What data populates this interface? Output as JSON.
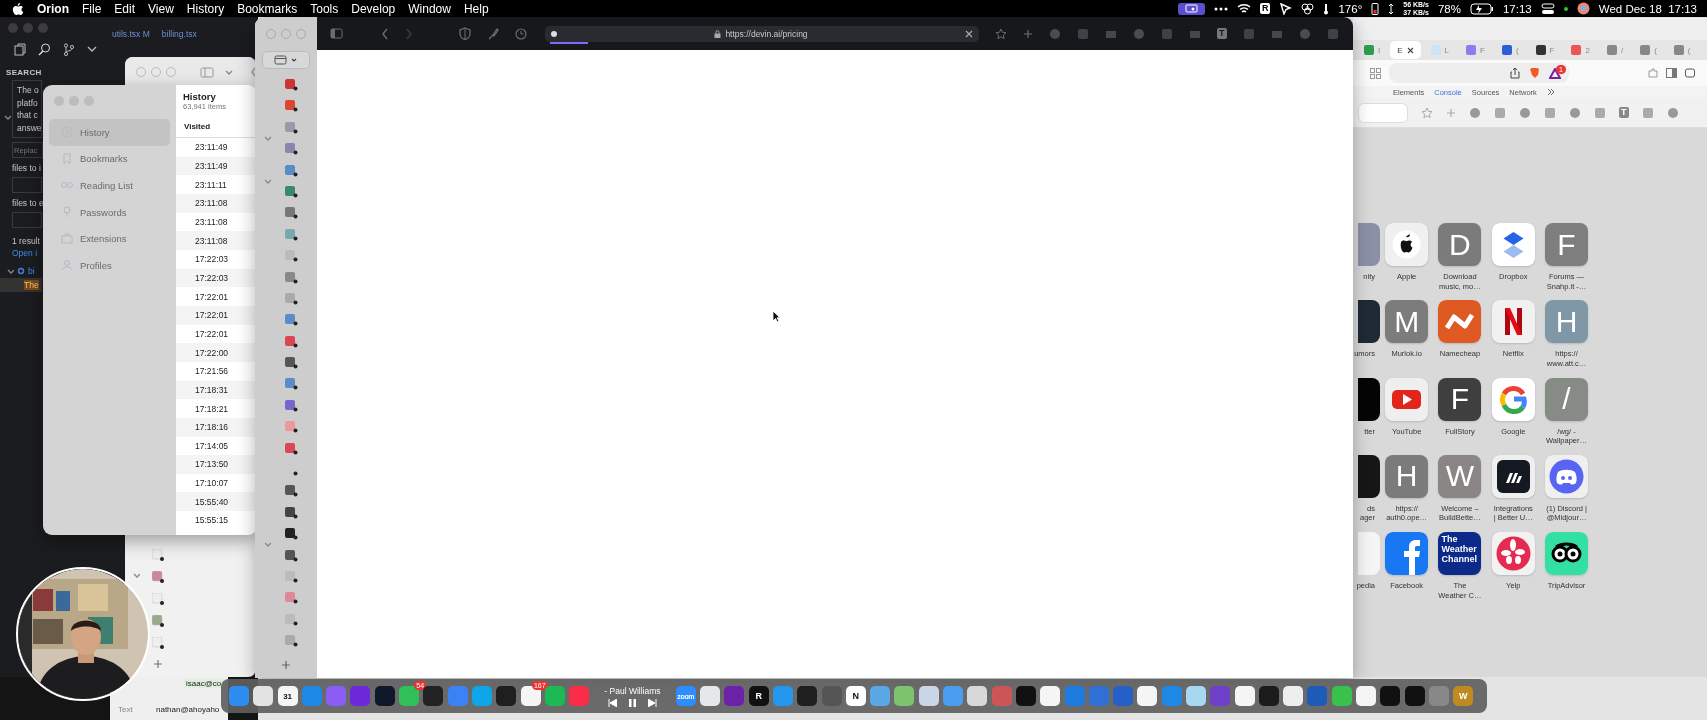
{
  "menu_bar": {
    "app_name": "Orion",
    "menus": [
      "File",
      "Edit",
      "View",
      "History",
      "Bookmarks",
      "Tools",
      "Develop",
      "Window",
      "Help"
    ],
    "letter_icon": "R",
    "temperature": "176°",
    "network_down": "56 KB/s",
    "network_up": "37 KB/s",
    "battery": "78%",
    "time": "17:13",
    "date_time": "Wed Dec 18  17:13"
  },
  "editor": {
    "tabs": [
      "utils.tsx M",
      "billing.tsx"
    ],
    "panel_title": "SEARCH",
    "search_text": [
      "The o",
      "platfo",
      "that c",
      "answe"
    ],
    "replace_placeholder": "Replac",
    "include_label": "files to i",
    "exclude_label": "files to e",
    "result_count": "1 result",
    "open_link": "Open i",
    "result_file": "bi",
    "result_match": "The"
  },
  "history_window": {
    "sidebar": [
      {
        "label": "History",
        "selected": true
      },
      {
        "label": "Bookmarks",
        "selected": false
      },
      {
        "label": "Reading List",
        "selected": false
      },
      {
        "label": "Passwords",
        "selected": false
      },
      {
        "label": "Extensions",
        "selected": false
      },
      {
        "label": "Profiles",
        "selected": false
      }
    ],
    "title": "History",
    "item_count": "63,941 items",
    "column": "Visited",
    "times": [
      "23:11:49",
      "23:11:49",
      "23:11:11",
      "23:11:08",
      "23:11:08",
      "23:11:08",
      "17:22:03",
      "17:22:03",
      "17:22:01",
      "17:22:01",
      "17:22:01",
      "17:22:00",
      "17:21:56",
      "17:18:31",
      "17:18:21",
      "17:18:16",
      "17:14:05",
      "17:13:50",
      "17:10:07",
      "15:55:40",
      "15:55:15"
    ]
  },
  "browser": {
    "url": "https://devin.ai/pricing",
    "loading": {
      "level": 0.09
    },
    "toolbar_letter": "T"
  },
  "second_browser": {
    "tabs": [
      {
        "label": "I",
        "selected": false
      },
      {
        "label": "E",
        "selected": true
      },
      {
        "label": "L",
        "selected": false
      },
      {
        "label": "F",
        "selected": false
      },
      {
        "label": "(",
        "selected": false
      },
      {
        "label": "F",
        "selected": false
      },
      {
        "label": "2",
        "selected": false
      },
      {
        "label": "/",
        "selected": false
      },
      {
        "label": "(",
        "selected": false
      },
      {
        "label": "(",
        "selected": false
      }
    ],
    "extension_badge": "1",
    "devtools_tabs": [
      {
        "label": "Elements",
        "selected": false
      },
      {
        "label": "Console",
        "selected": true
      },
      {
        "label": "Sources",
        "selected": false
      },
      {
        "label": "Network",
        "selected": false
      }
    ],
    "toolbar_letter": "T",
    "speed_dial": [
      {
        "kind": "partial",
        "label": "nity",
        "color": "#8c90a6"
      },
      {
        "kind": "logo",
        "label": "Apple"
      },
      {
        "kind": "letter",
        "letter": "D",
        "label": "Download\nmusic, mo…",
        "color": "#7b7b7b"
      },
      {
        "kind": "logo",
        "label": "Dropbox"
      },
      {
        "kind": "letter",
        "letter": "F",
        "label": "Forums —\nSnahp.it -…",
        "color": "#7e7e7e"
      },
      {
        "kind": "partial",
        "label": "umors",
        "color": "#1f2a36"
      },
      {
        "kind": "letter",
        "letter": "M",
        "label": "Murlok.io",
        "color": "#7c7c7c"
      },
      {
        "kind": "logo",
        "label": "Namecheap"
      },
      {
        "kind": "logo",
        "label": "Netflix"
      },
      {
        "kind": "letter",
        "letter": "H",
        "label": "https://\nwww.att.c…",
        "color": "#7f97a6"
      },
      {
        "kind": "partial",
        "label": "tter",
        "color": "#050505"
      },
      {
        "kind": "logo",
        "label": "YouTube"
      },
      {
        "kind": "letter",
        "letter": "F",
        "label": "FullStory",
        "color": "#3f3f3f"
      },
      {
        "kind": "logo",
        "label": "Google"
      },
      {
        "kind": "letter",
        "letter": "/",
        "label": "/wg/ -\nWallpaper…",
        "color": "#868b86"
      },
      {
        "kind": "partial",
        "label": "ds\nager",
        "color": "#161616"
      },
      {
        "kind": "letter",
        "letter": "H",
        "label": "https://\nauth0.ope…",
        "color": "#7b7b7b"
      },
      {
        "kind": "letter",
        "letter": "W",
        "label": "Welcome –\nBuildBette…",
        "color": "#8a8685"
      },
      {
        "kind": "logo",
        "label": "Integrations\n| Better U…"
      },
      {
        "kind": "logo",
        "label": "(1) Discord |\n@Midjour…"
      },
      {
        "kind": "partial",
        "label": "pedia",
        "color": "#f5f5f5"
      },
      {
        "kind": "logo",
        "label": "Facebook"
      },
      {
        "kind": "logo",
        "label": "The\nWeather C…",
        "logo_text": "The Weather Channel"
      },
      {
        "kind": "logo",
        "label": "Yelp"
      },
      {
        "kind": "logo",
        "label": "TripAdvisor"
      }
    ]
  },
  "mail_list": {
    "row_text": "isaac@co",
    "column_label": "Text",
    "cell": "nathan@ahoyaho"
  },
  "dock": {
    "date_text": "31",
    "badges": [
      "54",
      "167"
    ],
    "now_playing": "- Paul Williams",
    "icon_labels": [
      "zoom",
      "R",
      "N",
      "W"
    ]
  }
}
